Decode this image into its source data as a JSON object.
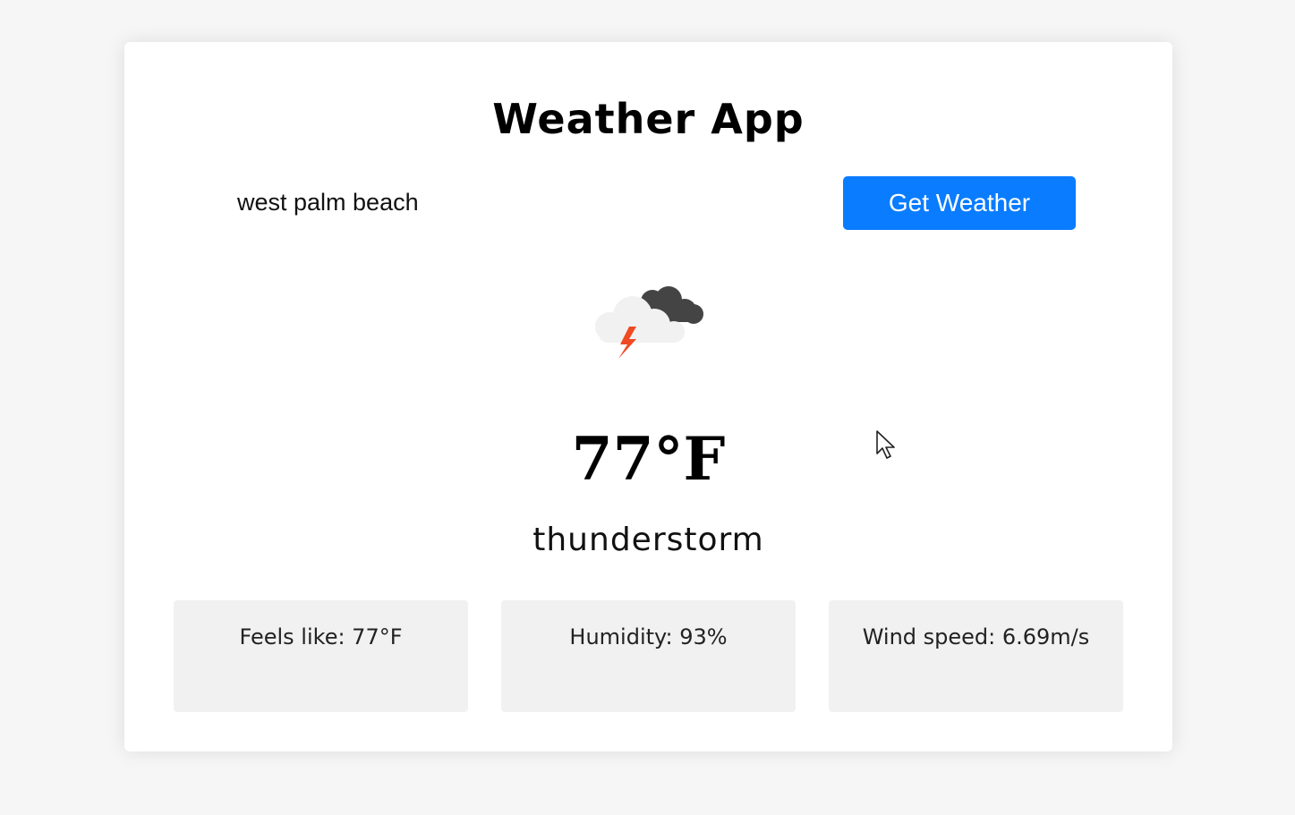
{
  "app": {
    "title": "Weather App"
  },
  "search": {
    "value": "west palm beach",
    "button_label": "Get Weather"
  },
  "weather": {
    "icon": "thunderstorm-cloud-icon",
    "temperature": "77°F",
    "description": "thunderstorm"
  },
  "details": {
    "feels_like": "Feels like: 77°F",
    "humidity": "Humidity: 93%",
    "wind_speed": "Wind speed: 6.69m/s"
  },
  "colors": {
    "page_background": "#f6f6f6",
    "card_background": "#ffffff",
    "button_background": "#0a7cff",
    "button_text": "#ffffff",
    "detail_box_background": "#f1f1f1",
    "lightning": "#f04a24"
  }
}
